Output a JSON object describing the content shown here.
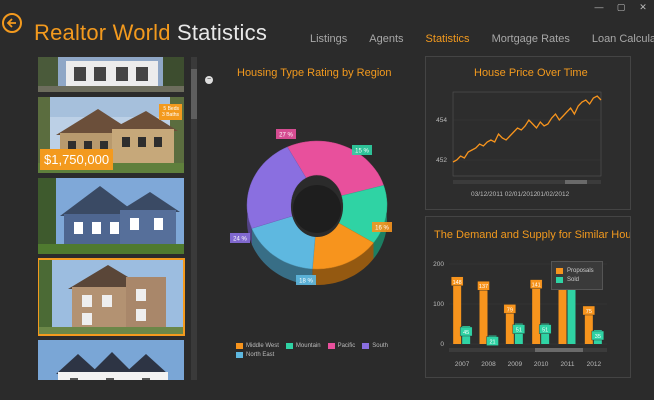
{
  "window": {
    "minimize": "—",
    "restore": "▢",
    "close": "✕"
  },
  "app": {
    "title_part1": "Realtor World",
    "title_part2": "Statistics"
  },
  "nav": [
    {
      "label": "Listings",
      "active": false
    },
    {
      "label": "Agents",
      "active": false
    },
    {
      "label": "Statistics",
      "active": true
    },
    {
      "label": "Mortgage Rates",
      "active": false
    },
    {
      "label": "Loan Calculator",
      "active": false
    }
  ],
  "listings": {
    "featured_price": "$1,750,000",
    "featured_badge": [
      "5 Beds",
      "3 Baths"
    ]
  },
  "colors": {
    "accent": "#f39a1e",
    "orange": "#f7941d",
    "teal": "#2fd3a4",
    "pink": "#e8509c",
    "purple": "#8a6fe0",
    "blue": "#5eb8e0"
  },
  "charts": {
    "pie_title": "Housing Type Rating by Region",
    "line_title": "House Price Over Time",
    "bar_title": "The Demand and Supply for Similar Hou"
  },
  "chart_data": [
    {
      "type": "pie",
      "title": "Housing Type Rating by Region",
      "slices": [
        {
          "name": "Middle West",
          "value": 16,
          "label": "16 %",
          "color": "#f7941d"
        },
        {
          "name": "Mountain",
          "value": 15,
          "label": "15 %",
          "color": "#2fd3a4"
        },
        {
          "name": "Pacific",
          "value": 27,
          "label": "27 %",
          "color": "#e8509c"
        },
        {
          "name": "South",
          "value": 24,
          "label": "24 %",
          "color": "#8a6fe0"
        },
        {
          "name": "North East",
          "value": 18,
          "label": "18 %",
          "color": "#5eb8e0"
        }
      ],
      "legend": [
        "Middle West",
        "Mountain",
        "Pacific",
        "South",
        "North East"
      ]
    },
    {
      "type": "line",
      "title": "House Price Over Time",
      "y_ticks": [
        452,
        454
      ],
      "ylim": [
        451.2,
        455.4
      ],
      "x_ticks": [
        "03/12/2011",
        "02/01/2012",
        "01/02/2012"
      ],
      "values": [
        451.9,
        452.0,
        452.2,
        452.1,
        452.4,
        452.5,
        452.6,
        452.8,
        452.7,
        452.9,
        453.0,
        452.9,
        453.3,
        453.1,
        453.0,
        453.2,
        453.4,
        453.6,
        453.5,
        453.7,
        454.0,
        453.8,
        453.6,
        453.9,
        453.7,
        453.8,
        454.1,
        454.3,
        454.0,
        454.2,
        454.4,
        454.6,
        454.3,
        454.7,
        454.9,
        455.0,
        454.8,
        455.1,
        455.2,
        455.0
      ]
    },
    {
      "type": "bar",
      "title": "The Demand and Supply for Similar Hou",
      "categories": [
        "2007",
        "2008",
        "2009",
        "2010",
        "2011",
        "2012"
      ],
      "series": [
        {
          "name": "Proposals",
          "color": "#f7941d",
          "values": [
            148,
            137,
            79,
            141,
            188,
            75
          ]
        },
        {
          "name": "Sold",
          "color": "#2fd3a4",
          "values": [
            45,
            21,
            51,
            51,
            172,
            35
          ]
        }
      ],
      "y_ticks": [
        0,
        100,
        200
      ],
      "ylim": [
        0,
        230
      ]
    }
  ]
}
